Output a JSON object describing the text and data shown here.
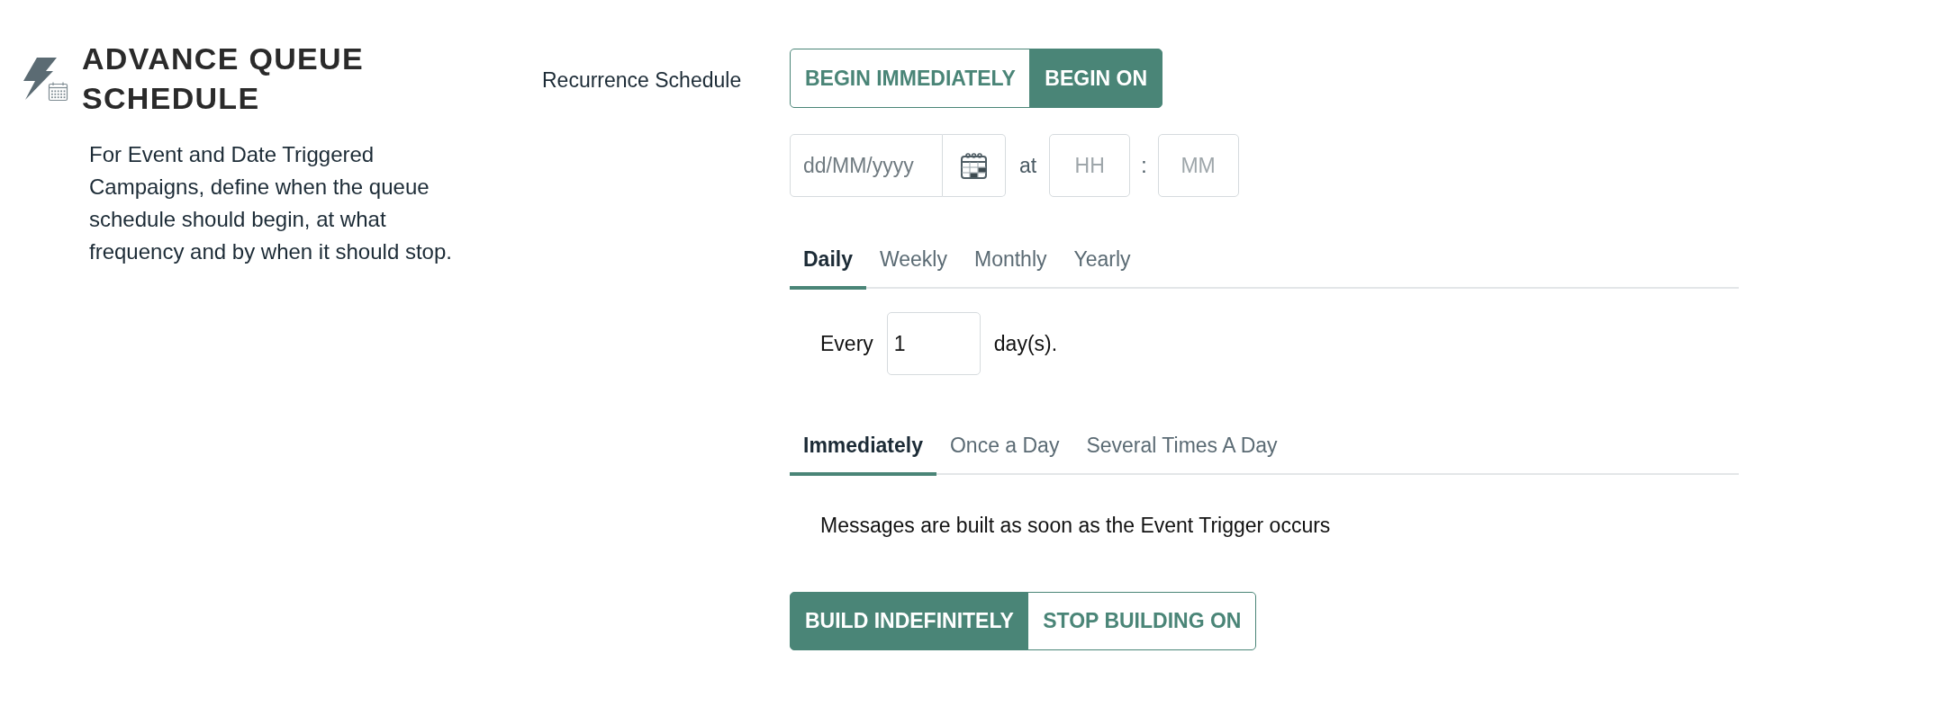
{
  "section": {
    "title": "ADVANCE QUEUE SCHEDULE",
    "description": "For Event and Date Triggered Campaigns, define when the queue schedule should begin, at what frequency and by when it should stop."
  },
  "recurrence_schedule": {
    "label": "Recurrence Schedule",
    "start_options": [
      {
        "label": "BEGIN IMMEDIATELY",
        "selected": false
      },
      {
        "label": "BEGIN ON",
        "selected": true
      }
    ],
    "start_date": {
      "placeholder": "dd/MM/yyyy"
    },
    "at_label": "at",
    "hour": {
      "placeholder": "HH"
    },
    "time_separator": ":",
    "minute": {
      "placeholder": "MM"
    },
    "frequency_tabs": [
      {
        "label": "Daily",
        "selected": true
      },
      {
        "label": "Weekly",
        "selected": false
      },
      {
        "label": "Monthly",
        "selected": false
      },
      {
        "label": "Yearly",
        "selected": false
      }
    ],
    "interval": {
      "prefix": "Every",
      "value": "1",
      "suffix": "day(s)."
    },
    "build_tabs": [
      {
        "label": "Immediately",
        "selected": true
      },
      {
        "label": "Once a Day",
        "selected": false
      },
      {
        "label": "Several Times A Day",
        "selected": false
      }
    ],
    "build_message": "Messages are built as soon as the Event Trigger occurs",
    "end_options": [
      {
        "label": "BUILD INDEFINITELY",
        "selected": true
      },
      {
        "label": "STOP BUILDING ON",
        "selected": false
      }
    ]
  }
}
